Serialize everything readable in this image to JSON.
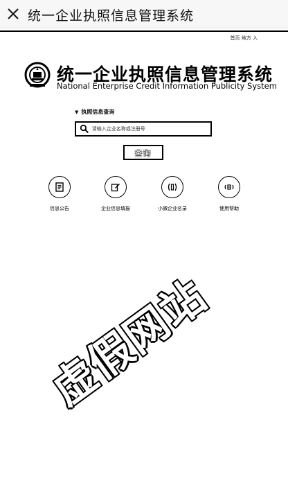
{
  "appbar": {
    "title": "统一企业执照信息管理系统"
  },
  "top_link": "首页 地方 入",
  "header": {
    "title_cn": "统一企业执照信息管理系统",
    "title_en": "National Enterprise Credit Information Publicity System"
  },
  "search": {
    "label": "执照信息查询",
    "placeholder": "请输入企业名称或注册号",
    "button": "查询"
  },
  "quick_links": [
    {
      "label": "信息公告",
      "icon": "notice-icon"
    },
    {
      "label": "企业信息填报",
      "icon": "edit-icon"
    },
    {
      "label": "小微企业名录",
      "icon": "directory-icon"
    },
    {
      "label": "使用帮助",
      "icon": "help-icon"
    }
  ],
  "watermark": "虚假网站"
}
